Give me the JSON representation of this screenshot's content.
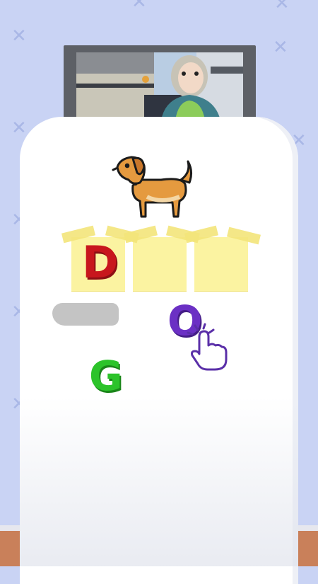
{
  "game": {
    "target_word_picture": "dog",
    "slots": [
      {
        "letter": "D",
        "color": "#c8161d"
      },
      {
        "letter": "",
        "color": ""
      },
      {
        "letter": "",
        "color": ""
      }
    ],
    "loose_letters": [
      {
        "letter": "O",
        "color": "#6b30c4"
      },
      {
        "letter": "G",
        "color": "#2cc32a"
      }
    ],
    "hint": "tap-hand-icon"
  },
  "colors": {
    "background": "#c9d3f4",
    "sticky_note": "#fbf3a1",
    "floor": "#c9805a"
  }
}
